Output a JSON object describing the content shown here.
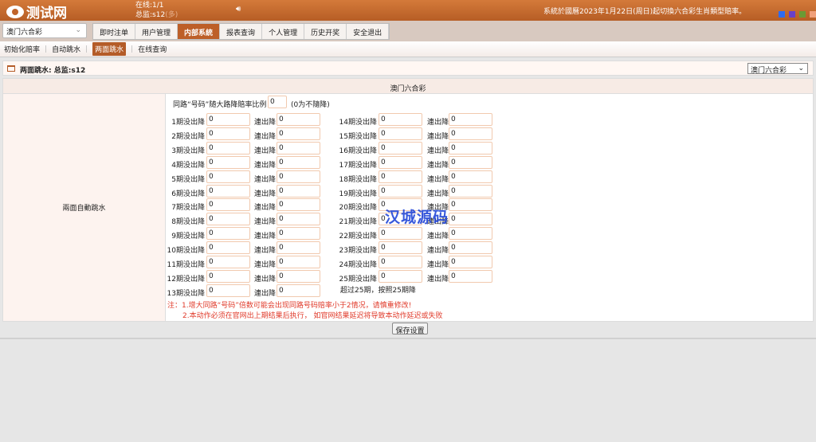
{
  "header": {
    "logo": "测试网",
    "online": "在线:1/1",
    "user": "总监:s12",
    "user_suffix": "(多)",
    "notice": "系統於國曆2023年1月22日(周日)起切換六合彩生肖類型賠率。",
    "swatches": [
      "#2f6bf0",
      "#6840c8",
      "#6b9a34",
      "#f0a07a"
    ]
  },
  "nav": {
    "lottery": "澳门六合彩",
    "menu": [
      "即时注单",
      "用户管理",
      "内部系統",
      "报表查询",
      "个人管理",
      "历史开奖",
      "安全退出"
    ],
    "active": 2
  },
  "subnav": {
    "items": [
      "初始化赔率",
      "自动跳水",
      "两面跳水",
      "在线查询"
    ],
    "active": 2
  },
  "title": {
    "text": "两面跳水: 总监:s12",
    "select": "澳门六合彩"
  },
  "table": {
    "header": "澳门六合彩",
    "left_label": "兩面自動跳水",
    "ratio_label": "同路“号码”随大路降賠率比例",
    "ratio_value": "0",
    "ratio_hint": "(0为不隨降)",
    "lian_label": "連出降",
    "col1": [
      {
        "label": "1期没出降",
        "v": "0",
        "l": "0"
      },
      {
        "label": "2期没出降",
        "v": "0",
        "l": "0"
      },
      {
        "label": "3期没出降",
        "v": "0",
        "l": "0"
      },
      {
        "label": "4期没出降",
        "v": "0",
        "l": "0"
      },
      {
        "label": "5期没出降",
        "v": "0",
        "l": "0"
      },
      {
        "label": "6期没出降",
        "v": "0",
        "l": "0"
      },
      {
        "label": "7期没出降",
        "v": "0",
        "l": "0"
      },
      {
        "label": "8期没出降",
        "v": "0",
        "l": "0"
      },
      {
        "label": "9期没出降",
        "v": "0",
        "l": "0"
      },
      {
        "label": "10期没出降",
        "v": "0",
        "l": "0"
      },
      {
        "label": "11期没出降",
        "v": "0",
        "l": "0"
      },
      {
        "label": "12期没出降",
        "v": "0",
        "l": "0"
      },
      {
        "label": "13期没出降",
        "v": "0",
        "l": "0"
      }
    ],
    "col2": [
      {
        "label": "14期没出降",
        "v": "0",
        "l": "0"
      },
      {
        "label": "15期没出降",
        "v": "0",
        "l": "0"
      },
      {
        "label": "16期没出降",
        "v": "0",
        "l": "0"
      },
      {
        "label": "17期没出降",
        "v": "0",
        "l": "0"
      },
      {
        "label": "18期没出降",
        "v": "0",
        "l": "0"
      },
      {
        "label": "19期没出降",
        "v": "0",
        "l": "0"
      },
      {
        "label": "20期没出降",
        "v": "0",
        "l": "0"
      },
      {
        "label": "21期没出降",
        "v": "0",
        "l": "0"
      },
      {
        "label": "22期没出降",
        "v": "0",
        "l": "0"
      },
      {
        "label": "23期没出降",
        "v": "0",
        "l": "0"
      },
      {
        "label": "24期没出降",
        "v": "0",
        "l": "0"
      },
      {
        "label": "25期没出降",
        "v": "0",
        "l": "0"
      }
    ],
    "over_note": "超过25期，按照25期降",
    "note1": "注：1.增大同路“号码”倍数可能会出现同路号码赔率小于2情况，请慎重修改!",
    "note2": "2.本动作必须在官网出上期结果后执行， 如官网结果延迟将导致本动作延迟或失败"
  },
  "save": "保存设置",
  "watermark": "汉城源码"
}
